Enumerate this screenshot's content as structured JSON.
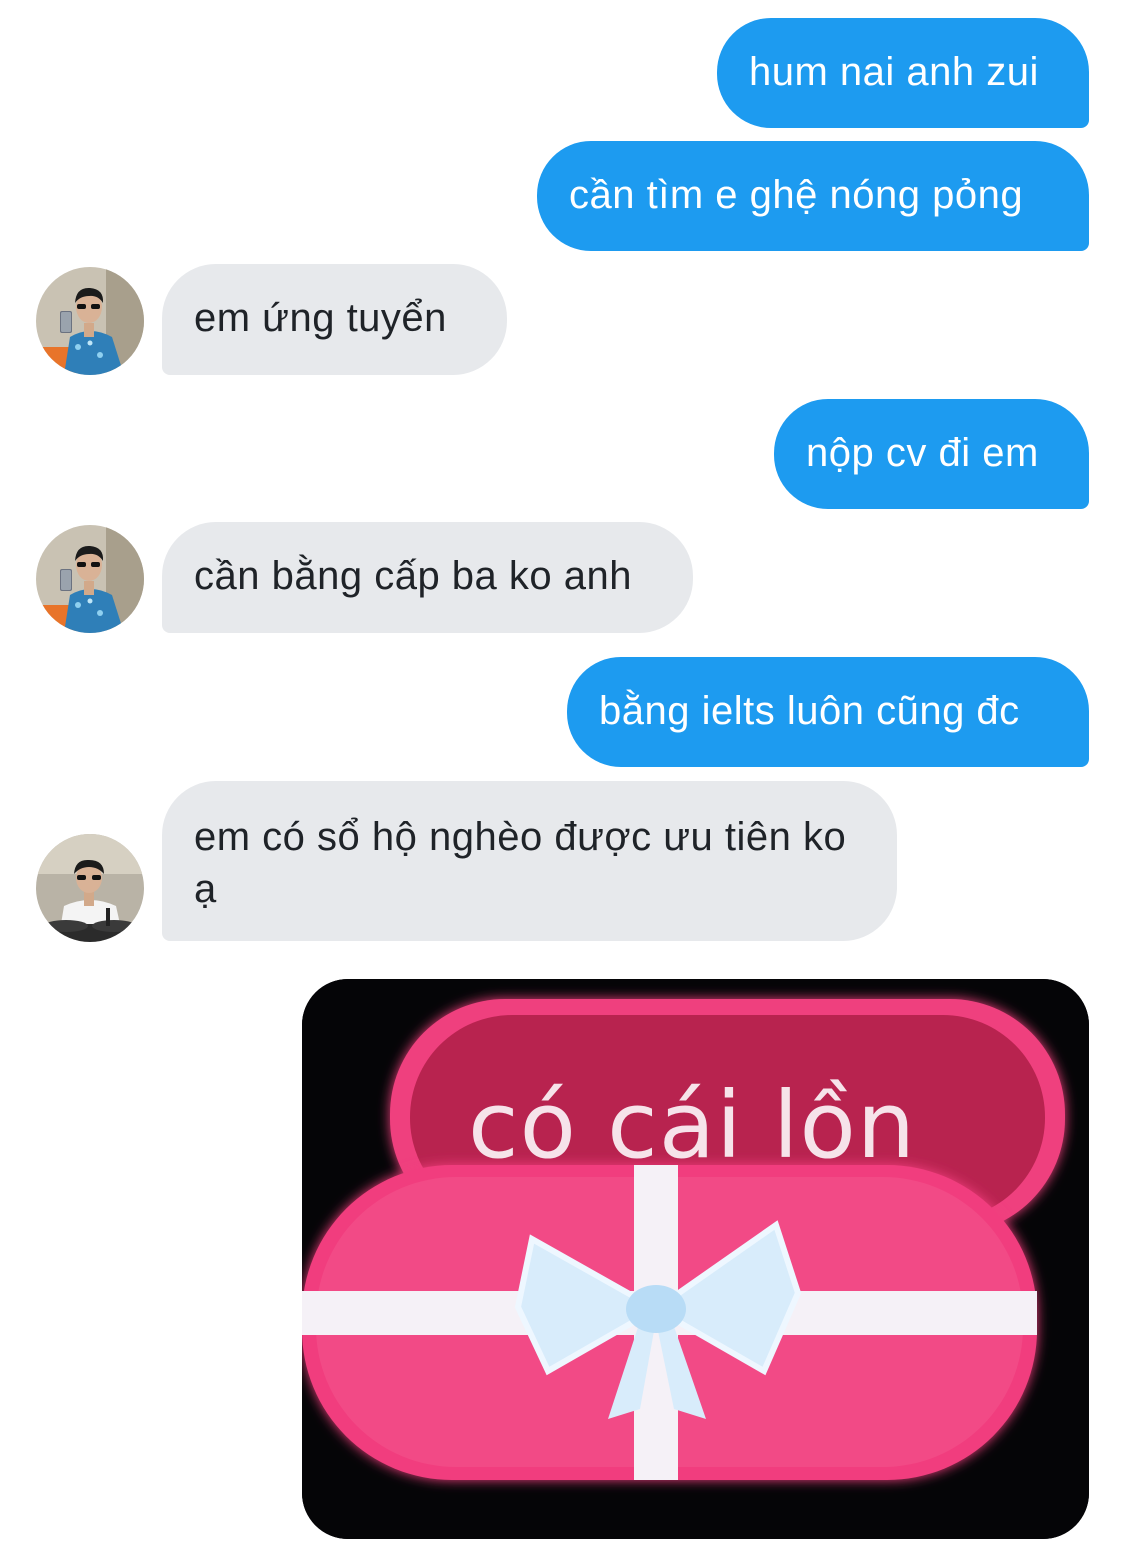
{
  "colors": {
    "outgoing_bubble": "#1d9bf0",
    "incoming_bubble": "#e7e9ec",
    "background": "#ffffff"
  },
  "messages": [
    {
      "direction": "outgoing",
      "text": "hum nai anh zui"
    },
    {
      "direction": "outgoing",
      "text": "cần tìm e ghệ nóng pỏng"
    },
    {
      "direction": "incoming",
      "text": "em ứng tuyển",
      "avatar": "profile-photo-blue-shirt"
    },
    {
      "direction": "outgoing",
      "text": "nộp cv đi em"
    },
    {
      "direction": "incoming",
      "text": "cần bằng cấp ba ko anh",
      "avatar": "profile-photo-blue-shirt"
    },
    {
      "direction": "outgoing",
      "text": "bằng ielts luôn cũng đc"
    },
    {
      "direction": "incoming",
      "text": "em có sổ hộ nghèo được ưu tiên ko ạ",
      "avatar": "profile-photo-white-shirt"
    },
    {
      "direction": "outgoing",
      "type": "image",
      "caption": "có cái lồn"
    }
  ]
}
